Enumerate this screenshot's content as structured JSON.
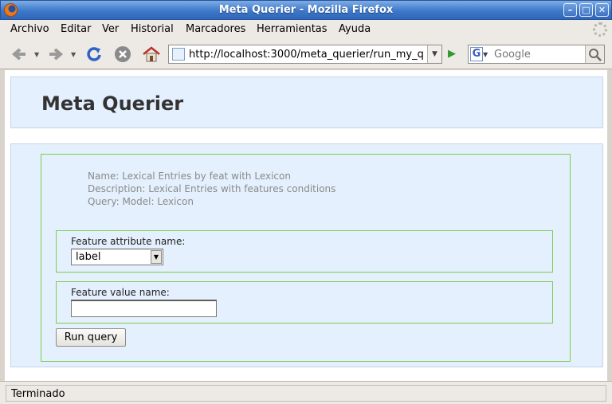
{
  "window": {
    "title": "Meta Querier - Mozilla Firefox"
  },
  "menubar": {
    "items": [
      "Archivo",
      "Editar",
      "Ver",
      "Historial",
      "Marcadores",
      "Herramientas",
      "Ayuda"
    ]
  },
  "navbar": {
    "url": "http://localhost:3000/meta_querier/run_my_q",
    "search_placeholder": "Google",
    "search_engine": "G"
  },
  "page": {
    "title": "Meta Querier",
    "meta": {
      "name": "Name: Lexical Entries by feat with Lexicon",
      "description": "Description: Lexical Entries with features conditions",
      "query": "Query: Model: Lexicon"
    },
    "feature_attribute": {
      "label": "Feature attribute name:",
      "selected": "label"
    },
    "feature_value": {
      "label": "Feature value name:",
      "value": ""
    },
    "run_button": "Run query"
  },
  "statusbar": {
    "text": "Terminado"
  },
  "colors": {
    "panel_bg": "#e4f0fd",
    "form_border": "#7ccd4a",
    "titlebar": "#3d78c9"
  }
}
